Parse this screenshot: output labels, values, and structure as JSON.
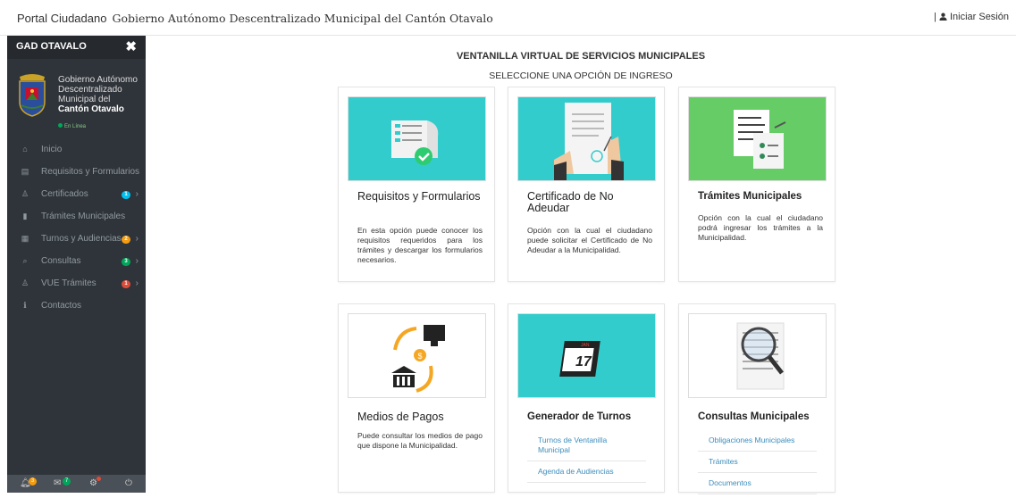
{
  "header": {
    "app_title": "Portal Ciudadano",
    "municipality": "Gobierno Autónomo Descentralizado Municipal del Cantón Otavalo",
    "separator": "|",
    "login_label": "Iniciar Sesión"
  },
  "sidebar": {
    "title": "GAD OTAVALO",
    "close_glyph": "✖",
    "profile": {
      "line1": "Gobierno Autónomo",
      "line2": "Descentralizado",
      "line3": "Municipal del",
      "line4": "Cantón Otavalo",
      "status": "En Línea"
    },
    "items": [
      {
        "label": "Inicio",
        "icon": "home-icon",
        "glyph": "⌂"
      },
      {
        "label": "Requisitos y Formularios",
        "icon": "form-icon",
        "glyph": "▤"
      },
      {
        "label": "Certificados",
        "icon": "user-icon",
        "glyph": "♙",
        "badge": "1",
        "badge_color": "#00c0ef"
      },
      {
        "label": "Trámites Municipales",
        "icon": "document-icon",
        "glyph": "▮"
      },
      {
        "label": "Turnos y Audiencias",
        "icon": "calendar-icon",
        "glyph": "▦",
        "badge": "2",
        "badge_color": "#f39c12"
      },
      {
        "label": "Consultas",
        "icon": "search-icon",
        "glyph": "⌕",
        "badge": "3",
        "badge_color": "#00a65a"
      },
      {
        "label": "VUE Trámites",
        "icon": "user-icon",
        "glyph": "♙",
        "badge": "1",
        "badge_color": "#dd4b39"
      },
      {
        "label": "Contactos",
        "icon": "info-icon",
        "glyph": "ℹ"
      }
    ],
    "footer": {
      "bell_badge": "3",
      "mail_badge": "7"
    }
  },
  "main": {
    "title": "VENTANILLA VIRTUAL DE SERVICIOS MUNICIPALES",
    "subtitle": "SELECCIONE UNA OPCIÓN DE INGRESO",
    "cards": [
      {
        "title": "Requisitos y Formularios",
        "text": "En esta opción puede conocer los requisitos requeridos para los trámites y descargar los formularios necesarios.",
        "image_bg": "#33cccc"
      },
      {
        "title": "Certificado de No Adeudar",
        "text": "Opción con la cual el ciudadano puede solicitar el Certificado de No Adeudar a la Municipalidad.",
        "image_bg": "#33cccc"
      },
      {
        "title": "Trámites Municipales",
        "text": "Opción con la cual el ciudadano podrá ingresar los trámites a la Municipalidad.",
        "image_bg": "#66cc66"
      },
      {
        "title": "Medios de Pagos",
        "text": "Puede consultar los medios de pago que dispone la Municipalidad.",
        "image_bg": "#ffffff"
      },
      {
        "title": "Generador de Turnos",
        "links": [
          "Turnos de Ventanilla Municipal",
          "Agenda de Audiencias"
        ],
        "image_bg": "#33cccc",
        "calendar_month": "JAN",
        "calendar_day": "17"
      },
      {
        "title": "Consultas Municipales",
        "links": [
          "Obligaciones Municipales",
          "Trámites",
          "Documentos"
        ],
        "image_bg": "#ffffff"
      }
    ]
  },
  "colors": {
    "sidebar_bg": "#2f343a",
    "link": "#3c8dbc",
    "teal": "#33cccc",
    "green": "#66cc66"
  }
}
